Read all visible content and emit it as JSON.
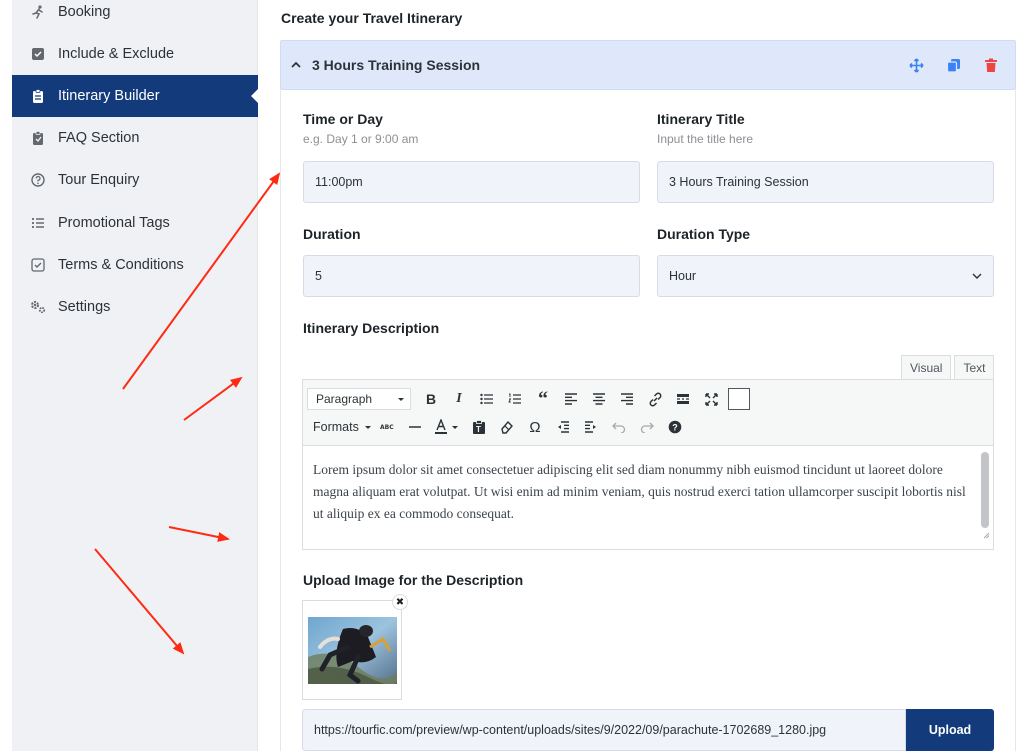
{
  "sidebar": {
    "items": [
      {
        "label": "Booking",
        "icon": "booking-icon"
      },
      {
        "label": "Include & Exclude",
        "icon": "checkbox-icon"
      },
      {
        "label": "Itinerary Builder",
        "icon": "clipboard-icon",
        "active": true
      },
      {
        "label": "FAQ Section",
        "icon": "clipboard-icon"
      },
      {
        "label": "Tour Enquiry",
        "icon": "question-icon"
      },
      {
        "label": "Promotional Tags",
        "icon": "list-icon"
      },
      {
        "label": "Terms & Conditions",
        "icon": "check-square-icon"
      },
      {
        "label": "Settings",
        "icon": "gear-icon"
      }
    ]
  },
  "main": {
    "title": "Create your Travel Itinerary",
    "accordion": {
      "title": "3 Hours Training Session",
      "action_icons": [
        "move-icon",
        "copy-icon",
        "trash-icon"
      ]
    },
    "fields": {
      "time_or_day": {
        "label": "Time or Day",
        "hint": "e.g. Day 1 or 9:00 am",
        "value": "11:00pm"
      },
      "itinerary_title": {
        "label": "Itinerary Title",
        "hint": "Input the title here",
        "value": "3 Hours Training Session"
      },
      "duration": {
        "label": "Duration",
        "value": "5"
      },
      "duration_type": {
        "label": "Duration Type",
        "value": "Hour"
      }
    },
    "description": {
      "label": "Itinerary Description",
      "tabs": {
        "visual": "Visual",
        "text": "Text"
      },
      "format_select": "Paragraph",
      "formats_menu": "Formats",
      "content": "Lorem ipsum dolor sit amet consectetuer adipiscing elit sed diam nonummy nibh euismod tincidunt ut laoreet dolore magna aliquam erat volutpat. Ut wisi enim ad minim veniam, quis nostrud exerci tation ullamcorper suscipit lobortis nisl ut aliquip ex ea commodo consequat."
    },
    "upload": {
      "label": "Upload Image for the Description",
      "url": "https://tourfic.com/preview/wp-content/uploads/sites/9/2022/09/parachute-1702689_1280.jpg",
      "button": "Upload"
    }
  },
  "colors": {
    "sidebar_active": "#133a7b",
    "accordion_header": "#dfe8fb",
    "action_blue": "#3b82f6",
    "action_red": "#ef4444",
    "annotation_arrow": "#ff2a12"
  }
}
